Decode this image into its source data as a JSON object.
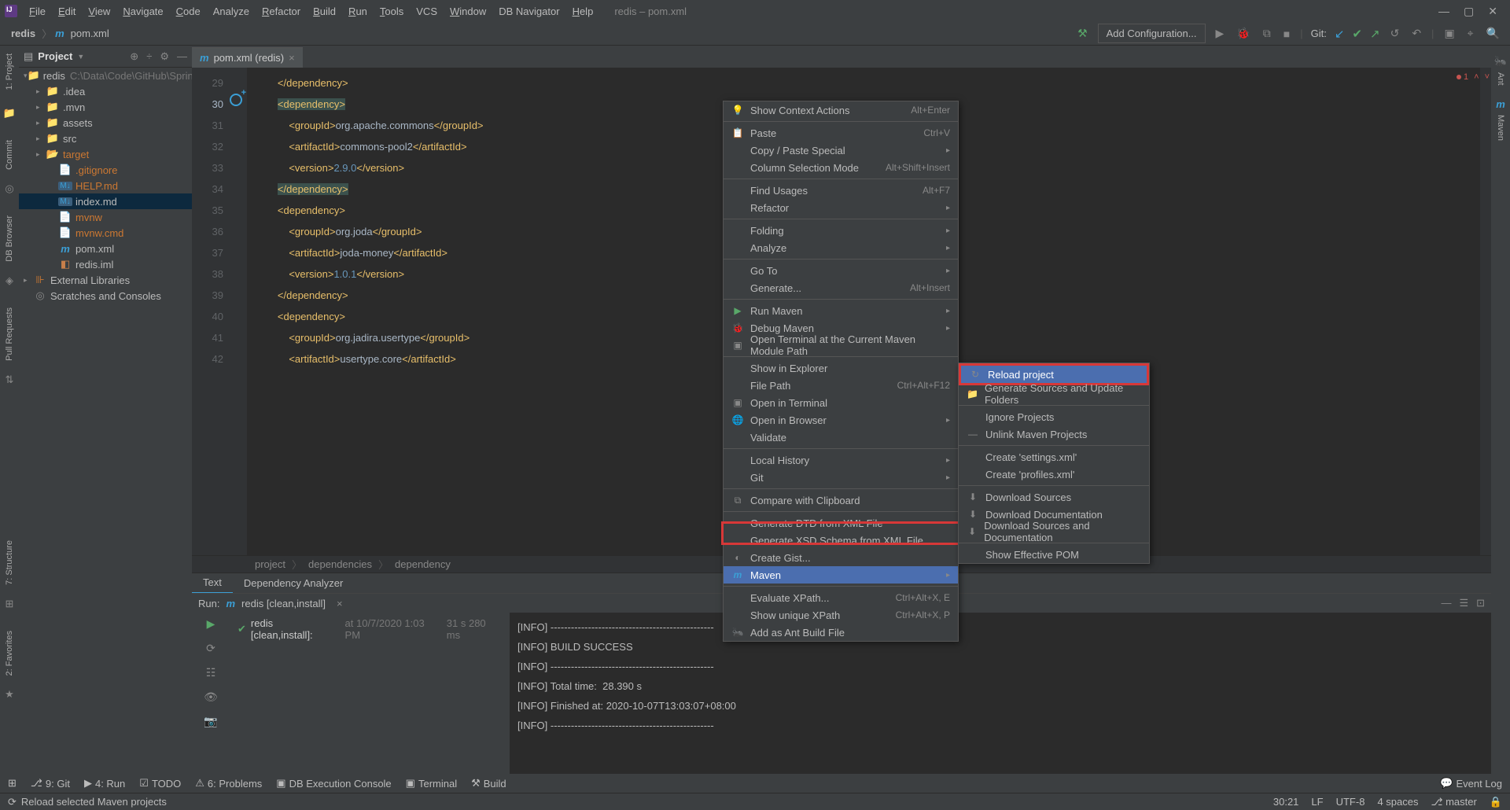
{
  "title": "redis – pom.xml",
  "menu": [
    "File",
    "Edit",
    "View",
    "Navigate",
    "Code",
    "Analyze",
    "Refactor",
    "Build",
    "Run",
    "Tools",
    "VCS",
    "Window",
    "DB Navigator",
    "Help"
  ],
  "menu_ul": [
    "F",
    "E",
    "V",
    "N",
    "C",
    null,
    "R",
    "B",
    "R",
    "T",
    null,
    "W",
    null,
    "H"
  ],
  "nav": {
    "root": "redis",
    "file_icon": "m",
    "file": "pom.xml",
    "add_conf": "Add Configuration...",
    "git": "Git:"
  },
  "left_rail": [
    "1: Project",
    "Commit",
    "DB Browser",
    "Pull Requests"
  ],
  "right_rail": [
    "Ant",
    "Maven"
  ],
  "sidebar": {
    "label": "Project",
    "tree": [
      {
        "lvl": 0,
        "arr": "▾",
        "ico": "folder",
        "name": "redis",
        "suffix": "C:\\Data\\Code\\GitHub\\Sprin",
        "cls": ""
      },
      {
        "lvl": 1,
        "arr": "▸",
        "ico": "folder",
        "name": ".idea"
      },
      {
        "lvl": 1,
        "arr": "▸",
        "ico": "folder",
        "name": ".mvn"
      },
      {
        "lvl": 1,
        "arr": "▸",
        "ico": "folder",
        "name": "assets"
      },
      {
        "lvl": 1,
        "arr": "▸",
        "ico": "folder",
        "name": "src"
      },
      {
        "lvl": 1,
        "arr": "▸",
        "ico": "folder-o",
        "name": "target",
        "cls": "orange"
      },
      {
        "lvl": 2,
        "arr": "",
        "ico": "gi",
        "name": ".gitignore",
        "cls": "orange"
      },
      {
        "lvl": 2,
        "arr": "",
        "ico": "md",
        "name": "HELP.md",
        "cls": "orange"
      },
      {
        "lvl": 2,
        "arr": "",
        "ico": "md",
        "name": "index.md",
        "sel": true
      },
      {
        "lvl": 2,
        "arr": "",
        "ico": "gi",
        "name": "mvnw",
        "cls": "orange"
      },
      {
        "lvl": 2,
        "arr": "",
        "ico": "gi",
        "name": "mvnw.cmd",
        "cls": "orange"
      },
      {
        "lvl": 2,
        "arr": "",
        "ico": "m",
        "name": "pom.xml"
      },
      {
        "lvl": 2,
        "arr": "",
        "ico": "iml",
        "name": "redis.iml"
      },
      {
        "lvl": 0,
        "arr": "▸",
        "ico": "libr",
        "name": "External Libraries"
      },
      {
        "lvl": 0,
        "arr": "",
        "ico": "scr",
        "name": "Scratches and Consoles"
      }
    ]
  },
  "tab": {
    "icon": "m",
    "label": "pom.xml (redis)"
  },
  "line_start": 29,
  "line_end": 42,
  "current_line": 30,
  "code_lines": [
    "        </dependency>",
    "        <dependency>",
    "            <groupId>org.apache.commons</groupId>",
    "            <artifactId>commons-pool2</artifactId>",
    "            <version>2.9.0</version>",
    "        </dependency>",
    "        <dependency>",
    "            <groupId>org.joda</groupId>",
    "            <artifactId>joda-money</artifactId>",
    "            <version>1.0.1</version>",
    "        </dependency>",
    "        <dependency>",
    "            <groupId>org.jadira.usertype</groupId>",
    "            <artifactId>usertype.core</artifactId>"
  ],
  "err_count": "1",
  "breadcrumb": [
    "project",
    "dependencies",
    "dependency"
  ],
  "sub_tabs": [
    "Text",
    "Dependency Analyzer"
  ],
  "run": {
    "label": "Run:",
    "conf": "redis [clean,install]",
    "task": "redis [clean,install]:",
    "ts": "at 10/7/2020 1:03 PM",
    "dur": "31 s 280 ms",
    "console": [
      "[INFO] ------------------------------------------------",
      "[INFO] BUILD SUCCESS",
      "[INFO] ------------------------------------------------",
      "[INFO] Total time:  28.390 s",
      "[INFO] Finished at: 2020-10-07T13:03:07+08:00",
      "[INFO] ------------------------------------------------"
    ]
  },
  "bottom": [
    "9: Git",
    "4: Run",
    "TODO",
    "6: Problems",
    "DB Execution Console",
    "Terminal",
    "Build"
  ],
  "bottom_right": "Event Log",
  "status": {
    "msg": "Reload selected Maven projects",
    "pos": "30:21",
    "le": "LF",
    "enc": "UTF-8",
    "indent": "4 spaces",
    "branch": "master"
  },
  "ctx": [
    {
      "ico": "💡",
      "lbl": "Show Context Actions",
      "sc": "Alt+Enter"
    },
    {
      "sep": 1
    },
    {
      "ico": "📋",
      "lbl": "Paste",
      "sc": "Ctrl+V"
    },
    {
      "lbl": "Copy / Paste Special",
      "arr": "▸"
    },
    {
      "lbl": "Column Selection Mode",
      "sc": "Alt+Shift+Insert"
    },
    {
      "sep": 1
    },
    {
      "lbl": "Find Usages",
      "sc": "Alt+F7"
    },
    {
      "lbl": "Refactor",
      "arr": "▸"
    },
    {
      "sep": 1
    },
    {
      "lbl": "Folding",
      "arr": "▸"
    },
    {
      "lbl": "Analyze",
      "arr": "▸"
    },
    {
      "sep": 1
    },
    {
      "lbl": "Go To",
      "arr": "▸"
    },
    {
      "lbl": "Generate...",
      "sc": "Alt+Insert"
    },
    {
      "sep": 1
    },
    {
      "ico": "▶",
      "lbl": "Run Maven",
      "arr": "▸",
      "iconColor": "#59a869"
    },
    {
      "ico": "🐞",
      "lbl": "Debug Maven",
      "arr": "▸"
    },
    {
      "ico": "▣",
      "lbl": "Open Terminal at the Current Maven Module Path"
    },
    {
      "sep": 1
    },
    {
      "lbl": "Show in Explorer"
    },
    {
      "lbl": "File Path",
      "sc": "Ctrl+Alt+F12"
    },
    {
      "ico": "▣",
      "lbl": "Open in Terminal"
    },
    {
      "ico": "🌐",
      "lbl": "Open in Browser",
      "arr": "▸"
    },
    {
      "lbl": "Validate"
    },
    {
      "sep": 1
    },
    {
      "lbl": "Local History",
      "arr": "▸"
    },
    {
      "lbl": "Git",
      "arr": "▸"
    },
    {
      "sep": 1
    },
    {
      "ico": "⧉",
      "lbl": "Compare with Clipboard"
    },
    {
      "sep": 1
    },
    {
      "lbl": "Generate DTD from XML File"
    },
    {
      "lbl": "Generate XSD Schema from XML File..."
    },
    {
      "ico": "◐",
      "lbl": "Create Gist..."
    },
    {
      "ico": "m",
      "lbl": "Maven",
      "arr": "▸",
      "hl": true,
      "iconColor": "#3b9fd6"
    },
    {
      "sep": 1
    },
    {
      "lbl": "Evaluate XPath...",
      "sc": "Ctrl+Alt+X, E"
    },
    {
      "lbl": "Show unique XPath",
      "sc": "Ctrl+Alt+X, P"
    },
    {
      "ico": "🐜",
      "lbl": "Add as Ant Build File"
    }
  ],
  "subctx": [
    {
      "ico": "↻",
      "lbl": "Reload project",
      "hl": true,
      "red": true
    },
    {
      "ico": "📁",
      "lbl": "Generate Sources and Update Folders"
    },
    {
      "sep": 1
    },
    {
      "lbl": "Ignore Projects"
    },
    {
      "ico": "—",
      "lbl": "Unlink Maven Projects"
    },
    {
      "sep": 1
    },
    {
      "lbl": "Create 'settings.xml'"
    },
    {
      "lbl": "Create 'profiles.xml'"
    },
    {
      "sep": 1
    },
    {
      "ico": "⬇",
      "lbl": "Download Sources"
    },
    {
      "ico": "⬇",
      "lbl": "Download Documentation"
    },
    {
      "ico": "⬇",
      "lbl": "Download Sources and Documentation"
    },
    {
      "sep": 1
    },
    {
      "lbl": "Show Effective POM"
    }
  ]
}
